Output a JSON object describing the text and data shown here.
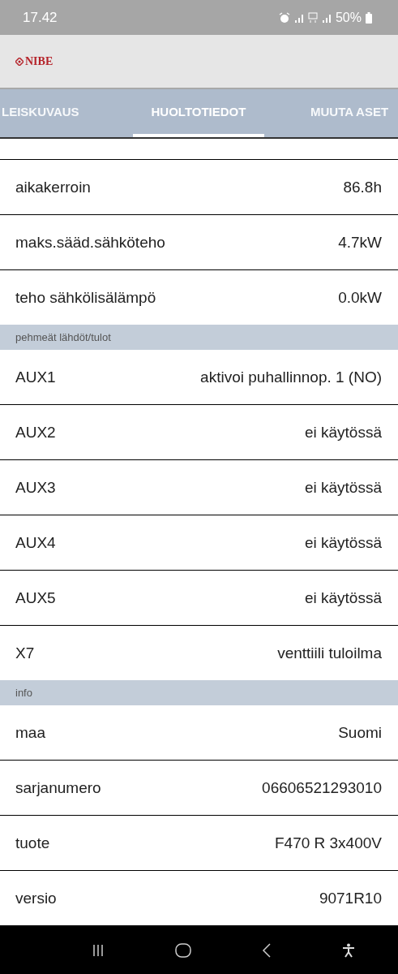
{
  "status_bar": {
    "time": "17.42",
    "battery": "50%"
  },
  "header": {
    "logo": "NIBE"
  },
  "tabs": [
    {
      "label": "LEISKUVAUS",
      "selected": false
    },
    {
      "label": "HUOLTOTIEDOT",
      "selected": true
    },
    {
      "label": "MUUTA ASET",
      "selected": false
    }
  ],
  "sections": [
    {
      "rows": [
        {
          "label": "aikakerroin",
          "value": "86.8h"
        },
        {
          "label": "maks.sääd.sähköteho",
          "value": "4.7kW"
        },
        {
          "label": "teho sähkölisälämpö",
          "value": "0.0kW"
        }
      ]
    },
    {
      "title": "pehmeät lähdöt/tulot",
      "rows": [
        {
          "label": "AUX1",
          "value": "aktivoi puhallinnop. 1 (NO)"
        },
        {
          "label": "AUX2",
          "value": "ei käytössä"
        },
        {
          "label": "AUX3",
          "value": "ei käytössä"
        },
        {
          "label": "AUX4",
          "value": "ei käytössä"
        },
        {
          "label": "AUX5",
          "value": "ei käytössä"
        },
        {
          "label": "X7",
          "value": "venttiili tuloilma"
        }
      ]
    },
    {
      "title": "info",
      "rows": [
        {
          "label": "maa",
          "value": "Suomi"
        },
        {
          "label": "sarjanumero",
          "value": "06606521293010"
        },
        {
          "label": "tuote",
          "value": "F470 R 3x400V"
        },
        {
          "label": "versio",
          "value": "9071R10"
        }
      ]
    }
  ]
}
